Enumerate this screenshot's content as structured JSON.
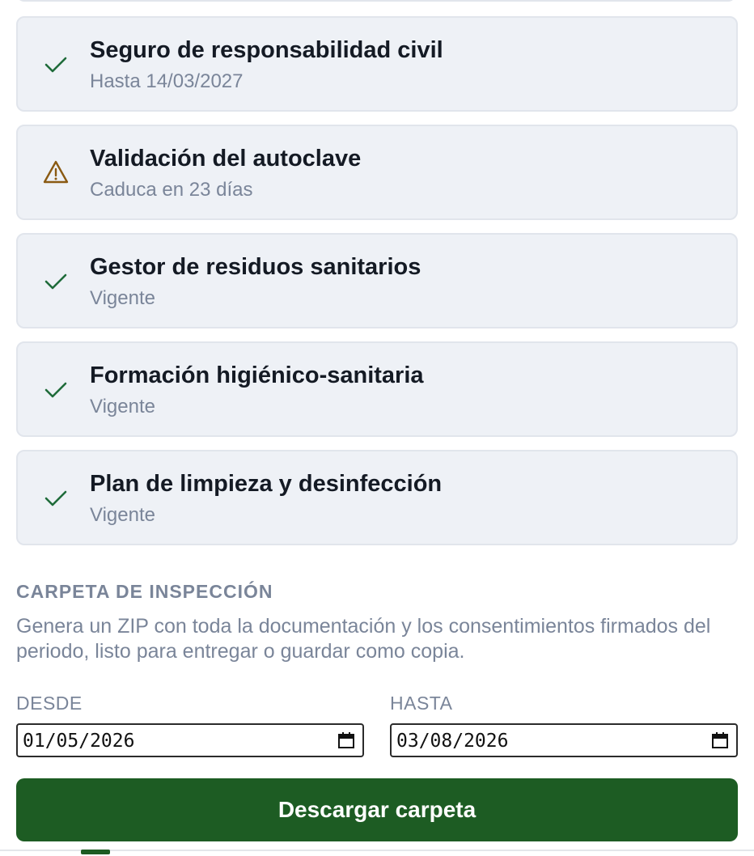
{
  "documents": [
    {
      "title": "Seguro de responsabilidad civil",
      "status": "Hasta 14/03/2027",
      "icon": "check-icon",
      "color": "#1f6b3a"
    },
    {
      "title": "Validación del autoclave",
      "status": "Caduca en 23 días",
      "icon": "warning-icon",
      "color": "#8a5a12"
    },
    {
      "title": "Gestor de residuos sanitarios",
      "status": "Vigente",
      "icon": "check-icon",
      "color": "#1f6b3a"
    },
    {
      "title": "Formación higiénico-sanitaria",
      "status": "Vigente",
      "icon": "check-icon",
      "color": "#1f6b3a"
    },
    {
      "title": "Plan de limpieza y desinfección",
      "status": "Vigente",
      "icon": "check-icon",
      "color": "#1f6b3a"
    }
  ],
  "inspection": {
    "heading": "CARPETA DE INSPECCIÓN",
    "description": "Genera un ZIP con toda la documentación y los consentimientos firmados del periodo, listo para entregar o guardar como copia.",
    "from_label": "DESDE",
    "from_value": "01/05/2026",
    "to_label": "HASTA",
    "to_value": "03/08/2026",
    "download_label": "Descargar carpeta"
  },
  "colors": {
    "accent": "#1d5c23",
    "card_bg": "#eef1f6",
    "muted_text": "#7a8599"
  }
}
